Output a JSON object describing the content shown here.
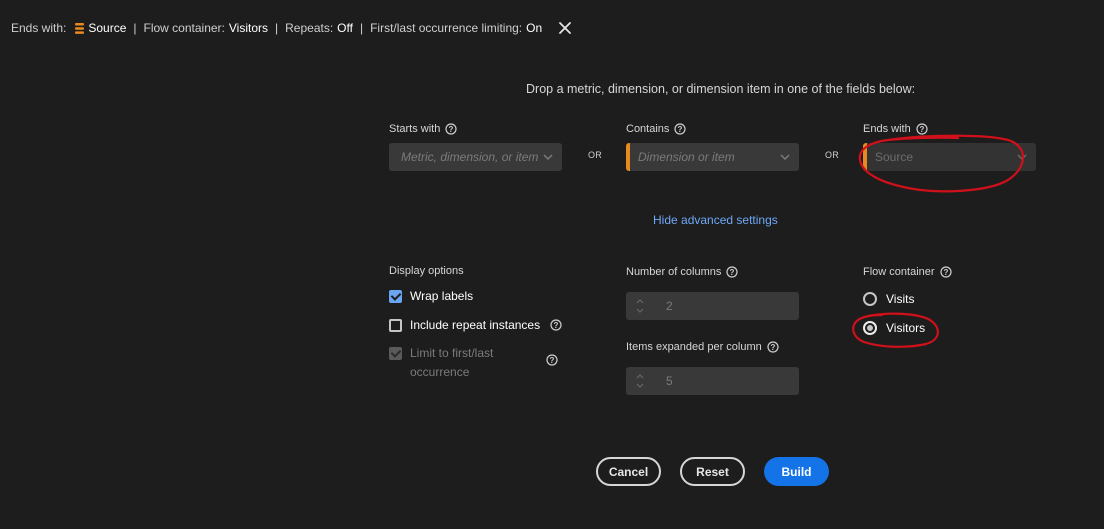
{
  "topbar": {
    "ends_with_label": "Ends with:",
    "ends_with_value": "Source",
    "flow_container_label": "Flow container:",
    "flow_container_value": "Visitors",
    "repeats_label": "Repeats:",
    "repeats_value": "Off",
    "limiting_label": "First/last occurrence limiting:",
    "limiting_value": "On",
    "separator": "|"
  },
  "instruction": "Drop a metric, dimension, or dimension item in one of the fields below:",
  "fields": {
    "starts_with": {
      "label": "Starts with",
      "placeholder": "Metric, dimension, or item"
    },
    "contains": {
      "label": "Contains",
      "placeholder": "Dimension or item"
    },
    "ends_with": {
      "label": "Ends with",
      "value": "Source"
    },
    "or_label": "OR"
  },
  "advanced_link": "Hide advanced settings",
  "display_options": {
    "title": "Display options",
    "wrap_labels": {
      "label": "Wrap labels",
      "checked": true
    },
    "include_repeat": {
      "label": "Include repeat instances",
      "checked": false
    },
    "limit_first_last": {
      "label": "Limit to first/last occurrence",
      "checked": true,
      "disabled": true
    }
  },
  "columns": {
    "number_label": "Number of columns",
    "number_value": "2",
    "items_label": "Items expanded per column",
    "items_value": "5"
  },
  "flow_container": {
    "title": "Flow container",
    "options": [
      {
        "label": "Visits",
        "selected": false
      },
      {
        "label": "Visitors",
        "selected": true
      }
    ]
  },
  "buttons": {
    "cancel": "Cancel",
    "reset": "Reset",
    "build": "Build"
  },
  "colors": {
    "accent": "#1473e6",
    "dimension": "#e88a1d",
    "link": "#6ea8f7",
    "annotation": "#d0101a"
  }
}
